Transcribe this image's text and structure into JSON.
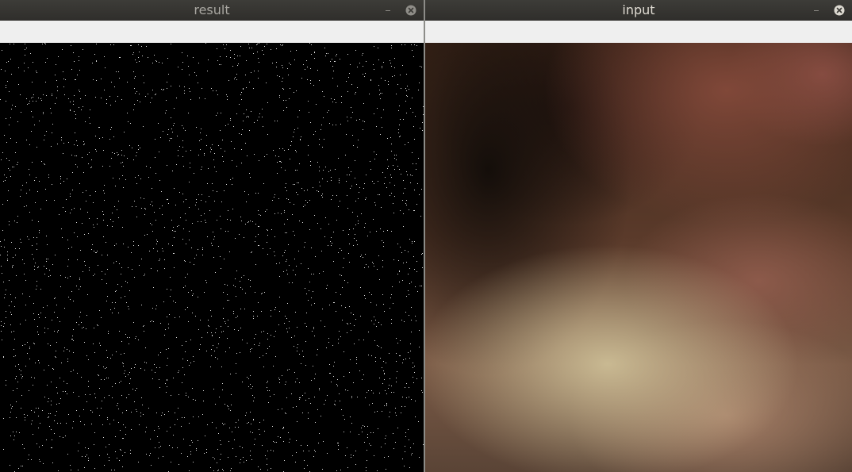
{
  "windows": {
    "result": {
      "title": "result",
      "minimize_icon": "minimize-icon",
      "close_icon": "close-icon"
    },
    "input": {
      "title": "input",
      "minimize_icon": "minimize-icon",
      "close_icon": "close-icon"
    }
  },
  "colors": {
    "titlebar": "#3c3b37",
    "result_canvas": "#000000",
    "noise_dots": "#ffffff",
    "close_active": "#dcd9d0",
    "close_inactive": "#8f8d88"
  }
}
